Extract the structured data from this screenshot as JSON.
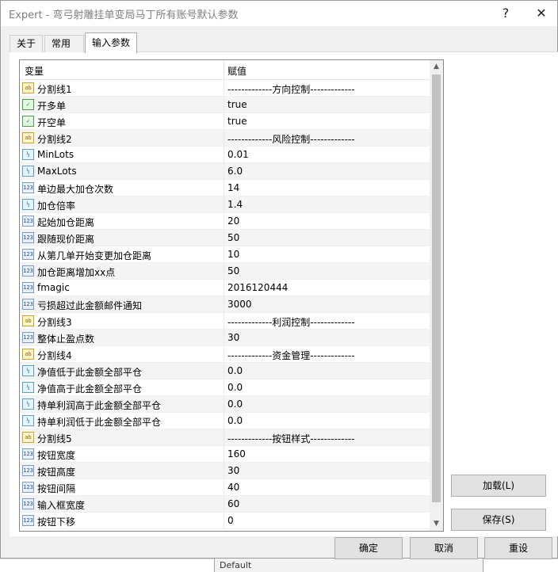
{
  "window": {
    "title": "Expert - 弯弓射雕挂单变局马丁所有账号默认参数",
    "help_glyph": "?",
    "close_glyph": "✕"
  },
  "tabs": [
    {
      "label": "关于"
    },
    {
      "label": "常用"
    },
    {
      "label": "输入参数"
    }
  ],
  "grid": {
    "header": {
      "variable": "变量",
      "value": "赋值"
    },
    "rows": [
      {
        "type": "abc",
        "icon_text": "ab",
        "name": "分割线1",
        "value": "-------------方向控制-------------"
      },
      {
        "type": "bool",
        "icon_text": "✓",
        "name": "开多单",
        "value": "true"
      },
      {
        "type": "bool",
        "icon_text": "✓",
        "name": "开空单",
        "value": "true"
      },
      {
        "type": "abc",
        "icon_text": "ab",
        "name": "分割线2",
        "value": "-------------风险控制-------------"
      },
      {
        "type": "dbl",
        "icon_text": "½",
        "name": "MinLots",
        "value": "0.01"
      },
      {
        "type": "dbl",
        "icon_text": "½",
        "name": "MaxLots",
        "value": "6.0"
      },
      {
        "type": "int",
        "icon_text": "123",
        "name": "单边最大加仓次数",
        "value": "14"
      },
      {
        "type": "dbl",
        "icon_text": "½",
        "name": "加仓倍率",
        "value": "1.4"
      },
      {
        "type": "int",
        "icon_text": "123",
        "name": "起始加仓距离",
        "value": "20"
      },
      {
        "type": "int",
        "icon_text": "123",
        "name": "跟随现价距离",
        "value": "50"
      },
      {
        "type": "int",
        "icon_text": "123",
        "name": "从第几单开始变更加仓距离",
        "value": "10"
      },
      {
        "type": "int",
        "icon_text": "123",
        "name": "加仓距离增加xx点",
        "value": "50"
      },
      {
        "type": "int",
        "icon_text": "123",
        "name": "fmagic",
        "value": "2016120444"
      },
      {
        "type": "int",
        "icon_text": "123",
        "name": "亏损超过此金额邮件通知",
        "value": "3000"
      },
      {
        "type": "abc",
        "icon_text": "ab",
        "name": "分割线3",
        "value": "-------------利润控制-------------"
      },
      {
        "type": "int",
        "icon_text": "123",
        "name": "整体止盈点数",
        "value": "30"
      },
      {
        "type": "abc",
        "icon_text": "ab",
        "name": "分割线4",
        "value": "-------------资金管理-------------"
      },
      {
        "type": "dbl",
        "icon_text": "½",
        "name": "净值低于此金额全部平仓",
        "value": "0.0"
      },
      {
        "type": "dbl",
        "icon_text": "½",
        "name": "净值高于此金额全部平仓",
        "value": "0.0"
      },
      {
        "type": "dbl",
        "icon_text": "½",
        "name": "持单利润高于此金额全部平仓",
        "value": "0.0"
      },
      {
        "type": "dbl",
        "icon_text": "½",
        "name": "持单利润低于此金额全部平仓",
        "value": "0.0"
      },
      {
        "type": "abc",
        "icon_text": "ab",
        "name": "分割线5",
        "value": "-------------按钮样式-------------"
      },
      {
        "type": "int",
        "icon_text": "123",
        "name": "按钮宽度",
        "value": "160"
      },
      {
        "type": "int",
        "icon_text": "123",
        "name": "按钮高度",
        "value": "30"
      },
      {
        "type": "int",
        "icon_text": "123",
        "name": "按钮间隔",
        "value": "40"
      },
      {
        "type": "int",
        "icon_text": "123",
        "name": "输入框宽度",
        "value": "60"
      },
      {
        "type": "int",
        "icon_text": "123",
        "name": "按钮下移",
        "value": "0"
      }
    ]
  },
  "side_buttons": {
    "load": "加载(L)",
    "save": "保存(S)"
  },
  "footer_buttons": {
    "ok": "确定",
    "cancel": "取消",
    "reset": "重设"
  },
  "background": {
    "bottom_tab_text": "Default"
  }
}
